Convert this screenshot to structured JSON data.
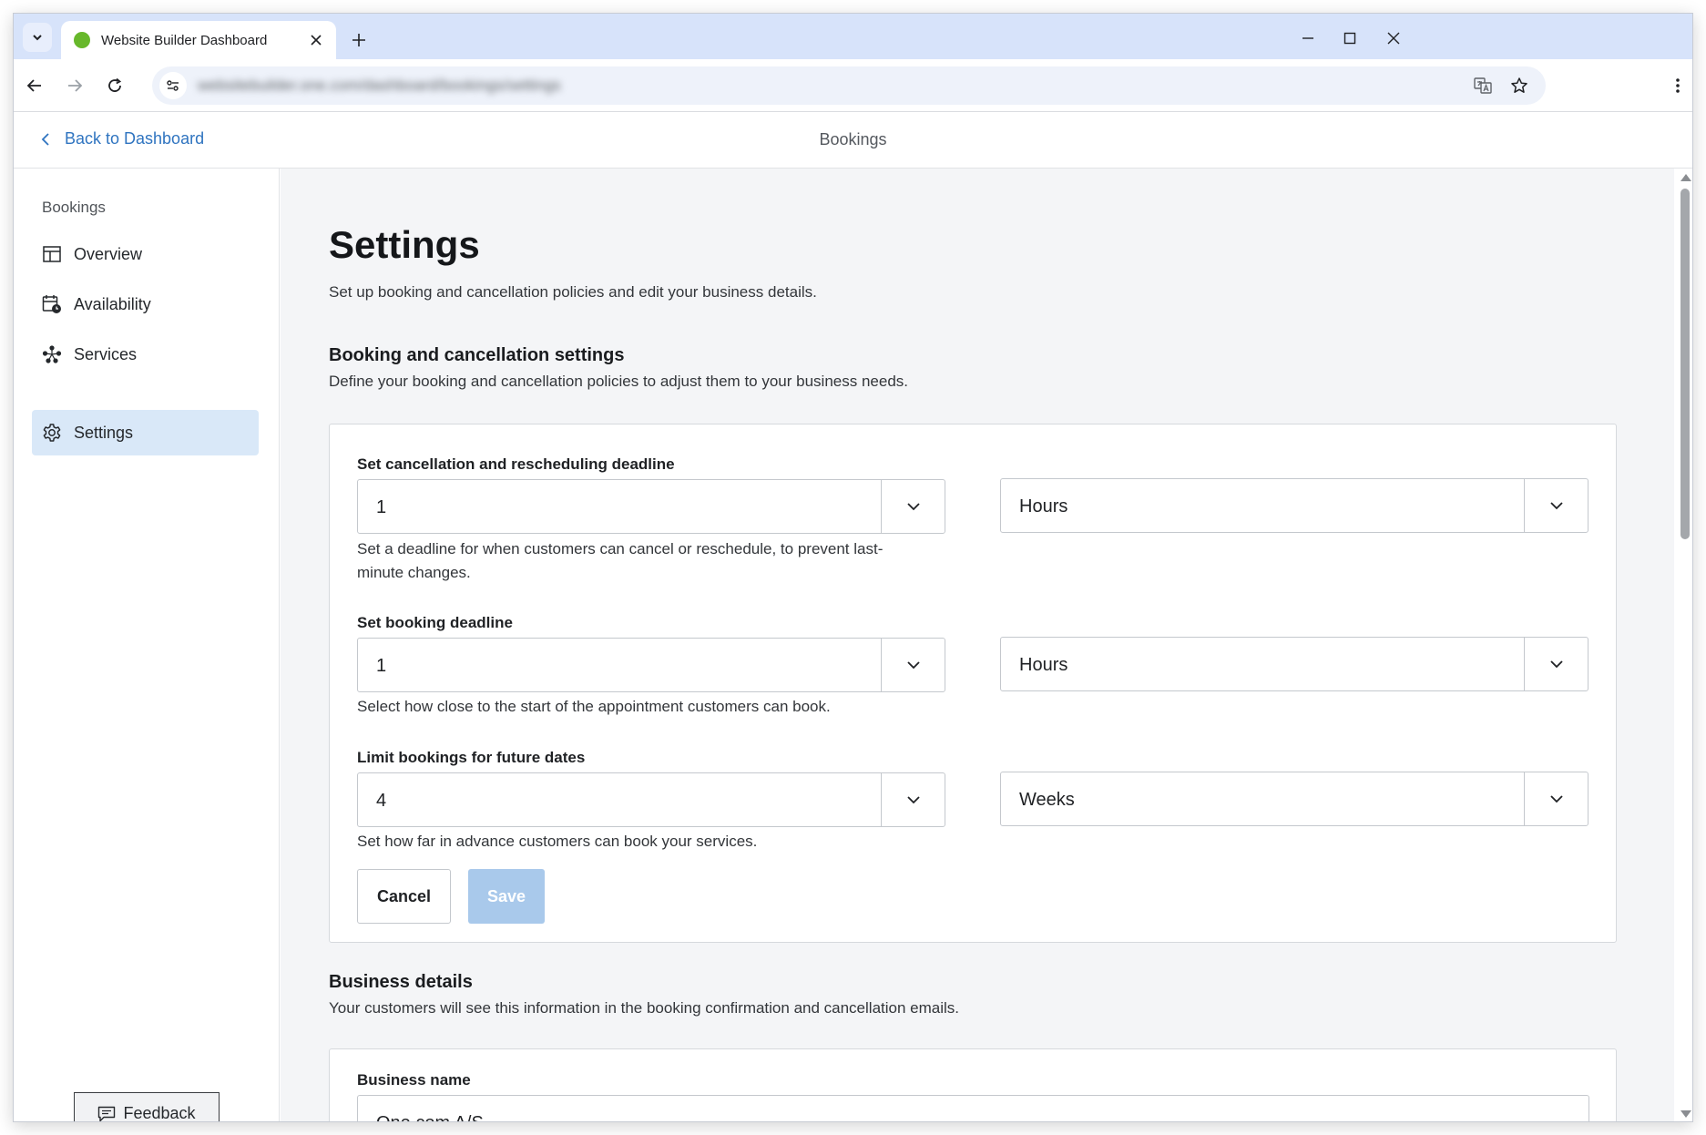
{
  "browser": {
    "tab_title": "Website Builder Dashboard",
    "url": "websitebuilder.one.com/dashboard/bookings/settings"
  },
  "header": {
    "back_label": "Back to Dashboard",
    "title": "Bookings"
  },
  "sidebar": {
    "heading": "Bookings",
    "items": [
      {
        "label": "Overview",
        "icon": "layout-icon"
      },
      {
        "label": "Availability",
        "icon": "calendar-clock-icon"
      },
      {
        "label": "Services",
        "icon": "services-icon"
      },
      {
        "label": "Settings",
        "icon": "gear-icon",
        "active": true
      }
    ],
    "feedback_label": "Feedback"
  },
  "main": {
    "title": "Settings",
    "subtitle": "Set up booking and cancellation policies and edit your business details.",
    "booking_section": {
      "title": "Booking and cancellation settings",
      "description": "Define your booking and cancellation policies to adjust them to your business needs.",
      "fields": [
        {
          "label": "Set cancellation and rescheduling deadline",
          "amount": "1",
          "unit": "Hours",
          "help_line1": "Set a deadline for when customers can cancel or reschedule, to prevent last-",
          "help_line2": "minute changes."
        },
        {
          "label": "Set booking deadline",
          "amount": "1",
          "unit": "Hours",
          "help": "Select how close to the start of the appointment customers can book."
        },
        {
          "label": "Limit bookings for future dates",
          "amount": "4",
          "unit": "Weeks",
          "help": "Set how far in advance customers can book your services."
        }
      ],
      "cancel_label": "Cancel",
      "save_label": "Save"
    },
    "business_section": {
      "title": "Business details",
      "description": "Your customers will see this information in the booking confirmation and cancellation emails.",
      "name_label": "Business name",
      "name_value": "One.com A/S"
    }
  },
  "colors": {
    "accent": "#2f74c0",
    "active_nav": "#d9e8f8",
    "save_disabled": "#a9c9eb",
    "tabstrip": "#d7e3fa"
  }
}
